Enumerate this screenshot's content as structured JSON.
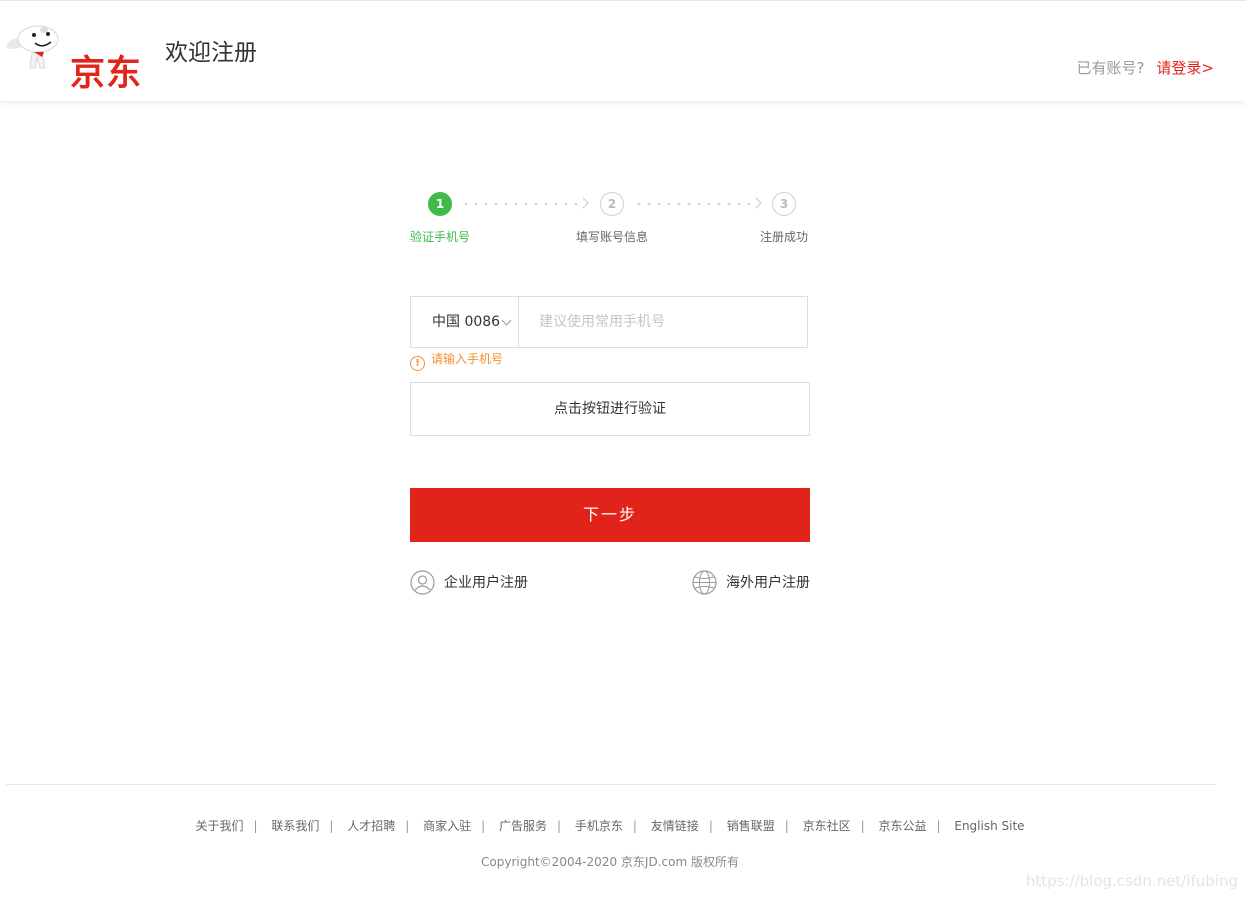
{
  "header": {
    "brand": "京东",
    "title": "欢迎注册",
    "have_account": "已有账号?",
    "login_link": "请登录>"
  },
  "steps": [
    {
      "number": "1",
      "label": "验证手机号",
      "state": "active"
    },
    {
      "number": "2",
      "label": "填写账号信息",
      "state": "idle"
    },
    {
      "number": "3",
      "label": "注册成功",
      "state": "idle"
    }
  ],
  "form": {
    "country_code": "中国 0086",
    "phone_placeholder": "建议使用常用手机号",
    "phone_value": "",
    "error_message": "请输入手机号",
    "verify_button": "点击按钮进行验证",
    "next_button": "下一步"
  },
  "alt_registration": {
    "enterprise": "企业用户注册",
    "overseas": "海外用户注册"
  },
  "footer": {
    "links": [
      "关于我们",
      "联系我们",
      "人才招聘",
      "商家入驻",
      "广告服务",
      "手机京东",
      "友情链接",
      "销售联盟",
      "京东社区",
      "京东公益",
      "English Site"
    ],
    "copyright": "Copyright©2004-2020  京东JD.com 版权所有"
  },
  "watermark": "https://blog.csdn.net/ifubing",
  "colors": {
    "brand_red": "#e1251b",
    "step_green": "#3ebb4b",
    "warning_orange": "#f0912f"
  }
}
